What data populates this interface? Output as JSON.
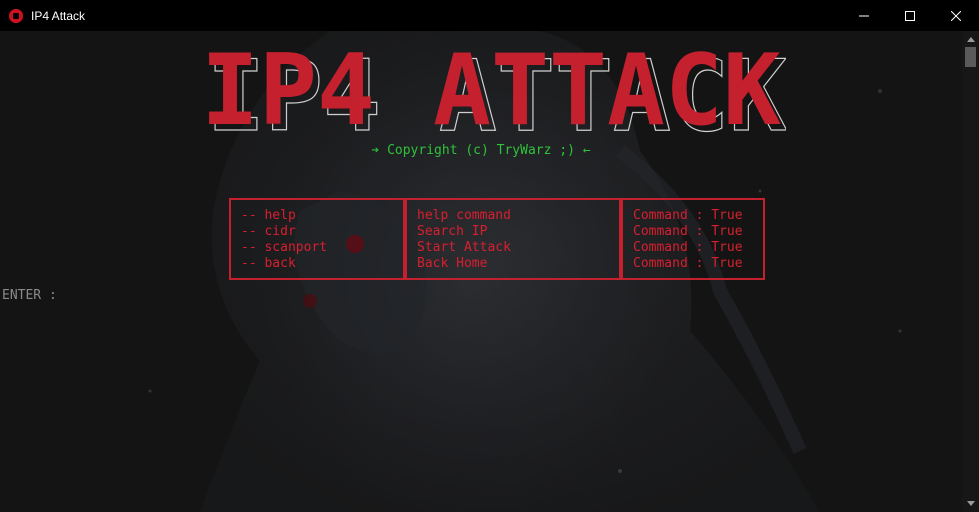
{
  "window": {
    "title": "IP4 Attack",
    "icon": "app-shield-icon",
    "controls": [
      "minimize-icon",
      "maximize-icon",
      "close-icon"
    ]
  },
  "banner": {
    "text": "IP4 ATTACK",
    "color": "#c4202e"
  },
  "copyright": "➔ Copyright (c) TryWarz ;) ←",
  "commands": {
    "names": [
      "-- help",
      "-- cidr",
      "-- scanport",
      "-- back"
    ],
    "descriptions": [
      "help command",
      "Search IP",
      "Start Attack",
      "Back Home"
    ],
    "status": [
      "Command : True",
      "Command : True",
      "Command : True",
      "Command : True"
    ]
  },
  "prompt": "ENTER :",
  "colors": {
    "accent_red": "#d81f2f",
    "border_red": "#c4202e",
    "copyright_green": "#2fc23a",
    "prompt_gray": "#8a8a8a"
  }
}
